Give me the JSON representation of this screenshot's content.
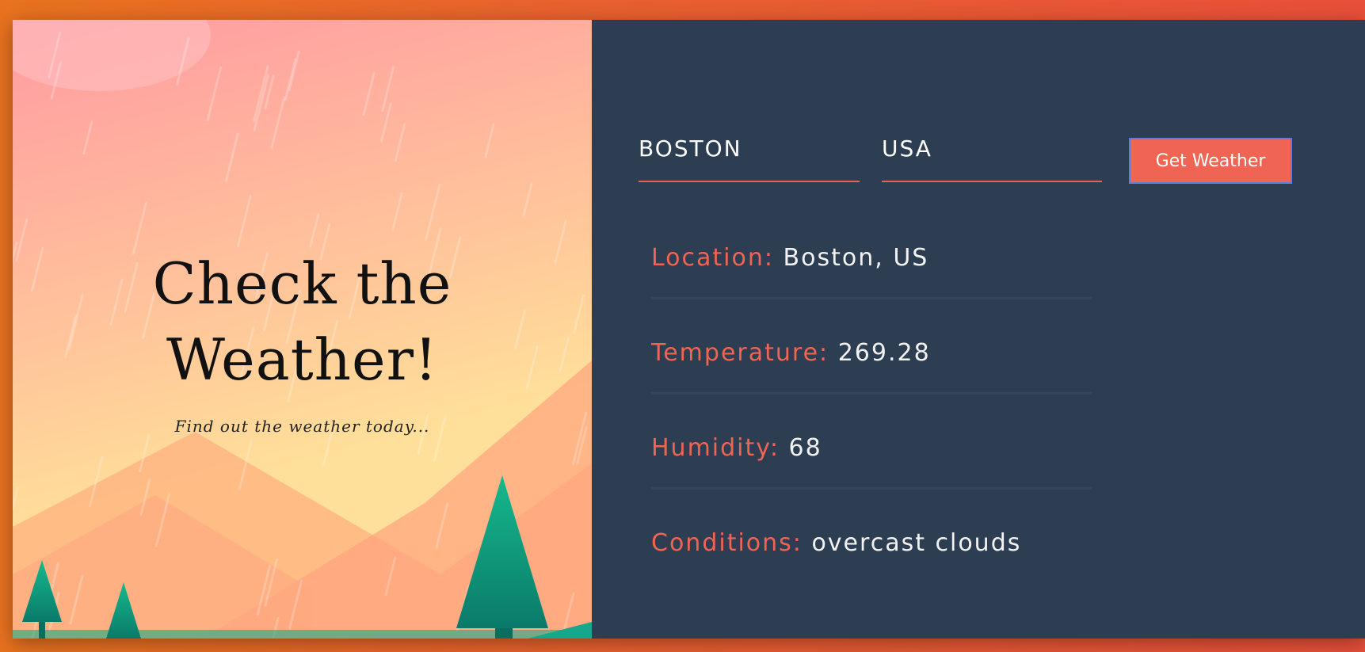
{
  "hero": {
    "title_line1": "Check the",
    "title_line2": "Weather!",
    "subtitle": "Find out the weather today..."
  },
  "form": {
    "city_value": "BOSTON",
    "country_value": "USA",
    "button_label": "Get Weather"
  },
  "results": {
    "location_label": "Location:",
    "location_value": "Boston, US",
    "temperature_label": "Temperature:",
    "temperature_value": "269.28",
    "humidity_label": "Humidity:",
    "humidity_value": "68",
    "conditions_label": "Conditions:",
    "conditions_value": "overcast clouds"
  },
  "colors": {
    "accent": "#ef6452",
    "panel_bg": "#2e3e52",
    "text_light": "#f2f2f2"
  }
}
